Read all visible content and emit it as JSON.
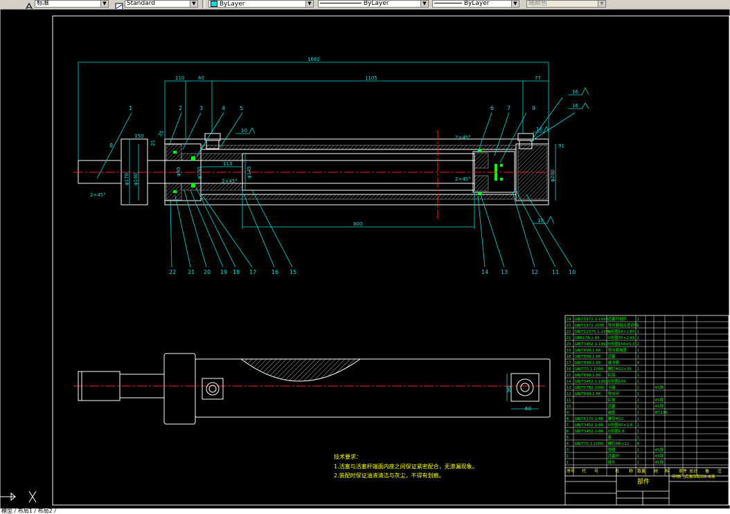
{
  "toolbar": {
    "text_style": "标准",
    "dim_style": "Standard",
    "layer": "ByLayer",
    "linetype": "ByLayer",
    "lineweight": "ByLayer",
    "plot_style": "随颜色"
  },
  "drawing": {
    "dims": {
      "overall": "1682",
      "d110": "110",
      "d60": "60",
      "d1105": "1105",
      "d77": "77",
      "d800": "800",
      "d113": "113",
      "d150": "150",
      "d21": "21",
      "d35": "35",
      "phi170": "φ170",
      "phi140": "φ140",
      "phi90": "φ90",
      "phi100": "φ100",
      "phi145": "φ145",
      "phi200": "φ200",
      "chamfer1": "2×45°",
      "chamfer2": "2×45°",
      "chamfer3": "2×45°",
      "chamfer4": "2×45°",
      "d91": "91",
      "d90": "90",
      "d60b": "60"
    },
    "roughness": [
      "10",
      "16",
      "16",
      "16",
      "10"
    ],
    "balloons_top": [
      "1",
      "2",
      "3",
      "4",
      "5",
      "6",
      "7",
      "8",
      "9",
      "6",
      "16",
      "16"
    ],
    "balloons_bottom": [
      "22",
      "21",
      "20",
      "19",
      "18",
      "17",
      "16",
      "15",
      "14",
      "13",
      "12",
      "11",
      "10"
    ],
    "tech_req": {
      "title": "技术要求：",
      "line1": "1.活塞与活塞杆端面内座之间保证紧密配合，无渗漏现象。",
      "line2": "2.装配时保证油液清洁与灰尘，不得有划痕。"
    },
    "title_block": {
      "part_name": "部件",
      "drawing_name": "中频门式液压缸D6-8液",
      "headers": [
        "序号",
        "代",
        "号",
        "名",
        "称",
        "数量",
        "材",
        "料",
        "单件",
        "总计",
        "备",
        "注"
      ]
    },
    "bom_rows": [
      [
        "24",
        "GB/T1972.3-1999",
        "活塞杆组件",
        "1",
        "",
        ""
      ],
      [
        "23",
        "GB/T1972-2005",
        "导向套组合密封件",
        "1",
        "",
        ""
      ],
      [
        "22",
        "GB/T12376.1-1999",
        "O形圈18×2.65",
        "1",
        "",
        ""
      ],
      [
        "21",
        "GB6178.1-86",
        "O形圈35×2.65",
        "1",
        "",
        ""
      ],
      [
        "20",
        "GB/T3452.1-1992",
        "O形圈150×5.3",
        "2",
        "",
        ""
      ],
      [
        "19",
        "GB/T898.1-86",
        "导向套端盖",
        "1",
        "",
        ""
      ],
      [
        "18",
        "GB/T898.1-86",
        "活塞",
        "1",
        "",
        ""
      ],
      [
        "17",
        "GB/T898.1-86",
        "缓冲套",
        "4",
        "",
        ""
      ],
      [
        "16",
        "GB/T70.1-2000",
        "螺钉M12×35",
        "1",
        "",
        ""
      ],
      [
        "15",
        "GB/T898.1-86",
        "缸底",
        "1",
        "",
        ""
      ],
      [
        "14",
        "GB/T3452.1-1992",
        "O形圈150",
        "1",
        "",
        ""
      ],
      [
        "13",
        "GB/T5782-2000",
        "卡键",
        "2",
        "45钢",
        ""
      ],
      [
        "12",
        "GB/T898.1-86",
        "导向环",
        "1",
        "",
        ""
      ],
      [
        "11",
        "",
        "缸体",
        "1",
        "45钢",
        ""
      ],
      [
        "10",
        "",
        "活塞",
        "1",
        "45钢",
        ""
      ],
      [
        "9",
        "",
        "端盖",
        "1",
        "HT200",
        ""
      ],
      [
        "8",
        "GB/T6170.1-86",
        "螺母M12",
        "1",
        "",
        ""
      ],
      [
        "7",
        "GB/T3452.1-86",
        "O形圈40×1.8",
        "1",
        "",
        ""
      ],
      [
        "6",
        "GB/T3452.1-86",
        "O形圈1.8",
        "1",
        "",
        ""
      ],
      [
        "5",
        "",
        "套",
        "1",
        "",
        ""
      ],
      [
        "4",
        "GB/T70.1-2000",
        "螺钉M6×12",
        "6",
        "",
        ""
      ],
      [
        "3",
        "",
        "垫圈",
        "1",
        "45钢",
        ""
      ],
      [
        "2",
        "",
        "活塞杆",
        "1",
        "45钢",
        ""
      ],
      [
        "1",
        "",
        "接头",
        "1",
        "45钢",
        ""
      ]
    ]
  },
  "colors": {
    "cyan": "#00e0e0",
    "green": "#00ff00",
    "red": "#ff2020",
    "white": "#ffffff",
    "yellow": "#ffff00"
  },
  "icons": {
    "text_style": "text-style-icon",
    "dim_style": "dim-style-icon",
    "layer_color": "layer-color-icon",
    "ucs": "ucs-icon"
  },
  "cmdline": {
    "text": "模型 / 布局1 / 布局2 /"
  }
}
